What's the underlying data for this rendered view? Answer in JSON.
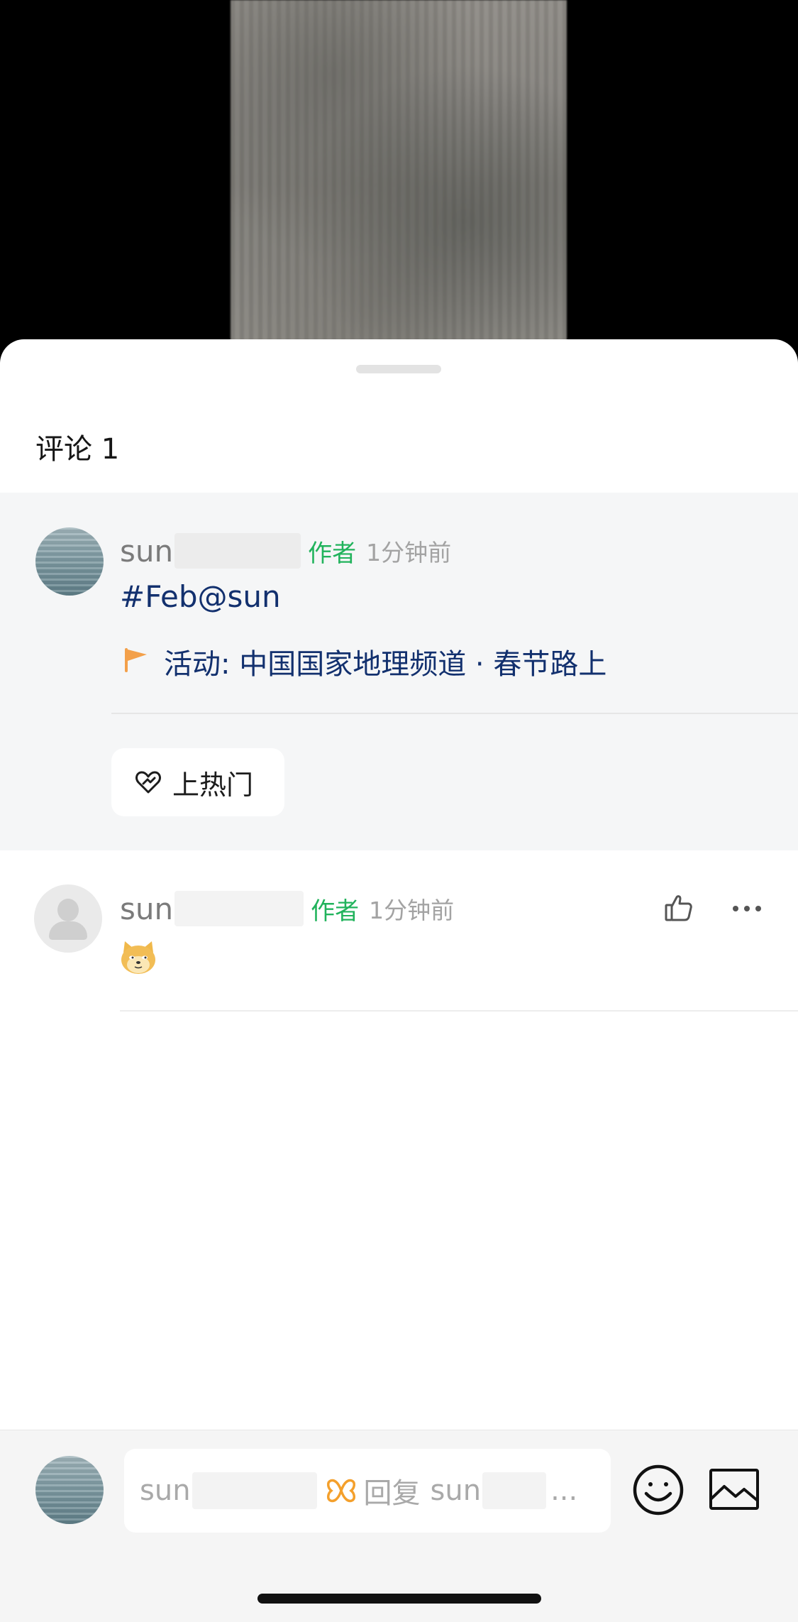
{
  "video": {},
  "comments_panel": {
    "title": "评论 1",
    "pinned_post": {
      "username": "sun",
      "author_tag": "作者",
      "time": "1分钟前",
      "topic": "#Feb@sun",
      "activity": "活动: 中国国家地理频道 · 春节路上",
      "hot_button_label": "上热门"
    },
    "comments": [
      {
        "username": "sun",
        "author_tag": "作者",
        "time": "1分钟前",
        "content_emoji": "doge-emoji"
      }
    ]
  },
  "reply_bar": {
    "prefix_user": "sun",
    "reply_word": "回复",
    "target_user": "sun",
    "ellipsis": "..."
  },
  "colors": {
    "author_green": "#21b35c",
    "link_navy": "#12306e",
    "flag_orange": "#f3a04a"
  }
}
